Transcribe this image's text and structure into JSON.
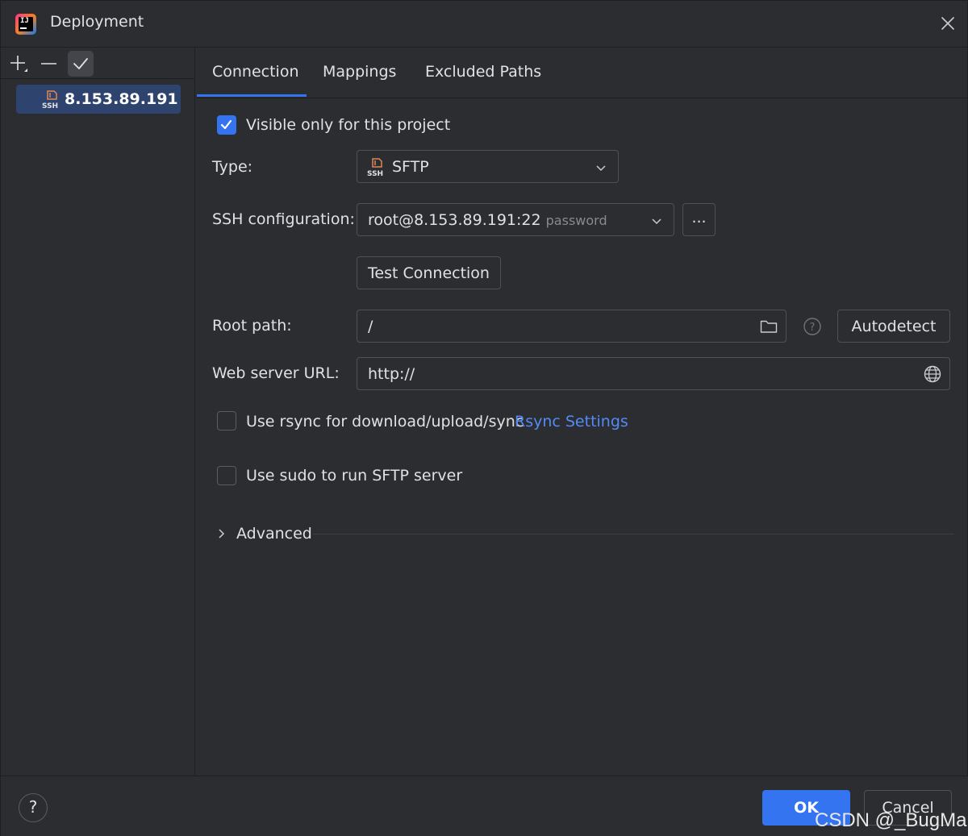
{
  "window": {
    "title": "Deployment",
    "app_icon": "jetbrains-ij-icon",
    "close_icon": "close-icon"
  },
  "left_panel": {
    "toolbar": {
      "add_icon": "plus-icon",
      "remove_icon": "minus-icon",
      "apply_icon": "check-icon"
    },
    "servers": [
      {
        "label": "8.153.89.191",
        "icon": "ssh-icon",
        "selected": true
      }
    ]
  },
  "tabs": [
    {
      "label": "Connection",
      "active": true
    },
    {
      "label": "Mappings",
      "active": false
    },
    {
      "label": "Excluded Paths",
      "active": false
    }
  ],
  "connection": {
    "visible_only": {
      "label": "Visible only for this project",
      "checked": true
    },
    "type": {
      "label": "Type:",
      "value": "SFTP",
      "icon": "ssh-icon"
    },
    "ssh_config": {
      "label": "SSH configuration:",
      "value": "root@8.153.89.191:22",
      "hint": "password",
      "more_label": "..."
    },
    "test_connection_label": "Test Connection",
    "root_path": {
      "label": "Root path:",
      "value": "/",
      "folder_icon": "folder-icon",
      "help_icon": "question-icon",
      "autodetect_label": "Autodetect"
    },
    "web_server_url": {
      "label": "Web server URL:",
      "value": "http://",
      "globe_icon": "globe-icon"
    },
    "use_rsync": {
      "label": "Use rsync for download/upload/sync",
      "checked": false,
      "link": "Rsync Settings"
    },
    "use_sudo": {
      "label": "Use sudo to run SFTP server",
      "checked": false
    },
    "advanced": {
      "label": "Advanced",
      "expanded": false
    }
  },
  "footer": {
    "help_label": "?",
    "ok_label": "OK",
    "cancel_label": "Cancel"
  },
  "watermark": "CSDN @_BugMan",
  "colors": {
    "background": "#2b2d30",
    "accent": "#3574f0",
    "selection": "#2e436e",
    "link": "#548af7",
    "border": "#4e5157"
  }
}
